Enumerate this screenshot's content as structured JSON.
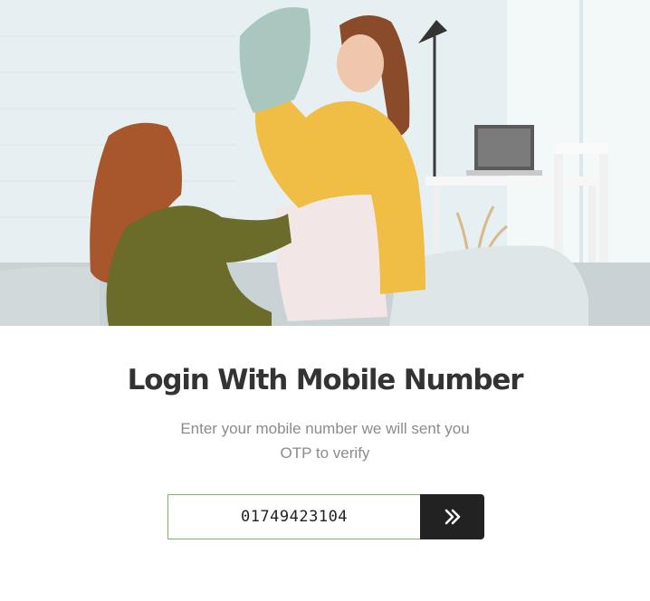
{
  "hero": {
    "image_alt_name": "women-pillow-fight-photo"
  },
  "login": {
    "title": "Login With Mobile Number",
    "subtitle": "Enter your mobile number we will sent you OTP to verify",
    "phone_value": "01749423104",
    "submit_icon": "double-chevron-right-icon"
  },
  "colors": {
    "title": "#333333",
    "subtitle": "#8b8b8b",
    "input_border": "#7ab56a",
    "button_bg": "#222222",
    "button_icon": "#ffffff"
  }
}
